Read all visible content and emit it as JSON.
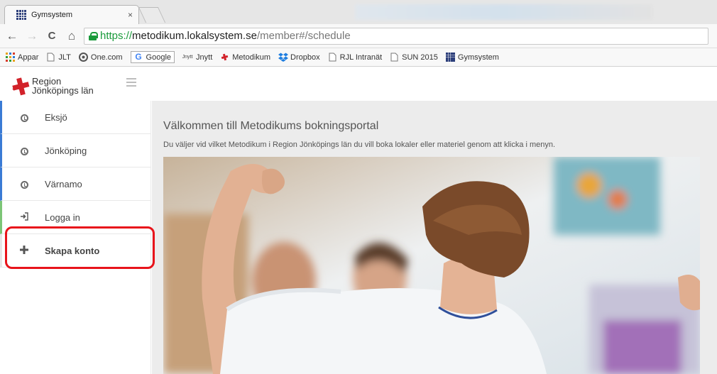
{
  "browser": {
    "tab_title": "Gymsystem",
    "tab_close": "×",
    "url_scheme": "https://",
    "url_host": "metodikum.lokalsystem.se",
    "url_path": "/member#/schedule",
    "nav": {
      "back": "←",
      "forward": "→",
      "reload": "C",
      "home": "⌂"
    },
    "bookmarks": [
      {
        "label": "Appar",
        "icon": "apps-grid-icon"
      },
      {
        "label": "JLT",
        "icon": "page-icon"
      },
      {
        "label": "One.com",
        "icon": "onecom-icon"
      },
      {
        "label": "Google",
        "icon": "google-icon"
      },
      {
        "label": "Jnytt",
        "icon": "jnytt-icon"
      },
      {
        "label": "Metodikum",
        "icon": "cross-icon"
      },
      {
        "label": "Dropbox",
        "icon": "dropbox-icon"
      },
      {
        "label": "RJL Intranät",
        "icon": "page-icon"
      },
      {
        "label": "SUN 2015",
        "icon": "page-icon"
      },
      {
        "label": "Gymsystem",
        "icon": "gymsystem-icon"
      }
    ]
  },
  "header": {
    "logo_line1": "Region",
    "logo_line2": "Jönköpings län"
  },
  "sidebar": {
    "items": [
      {
        "label": "Eksjö",
        "icon": "clock-icon"
      },
      {
        "label": "Jönköping",
        "icon": "clock-icon"
      },
      {
        "label": "Värnamo",
        "icon": "clock-icon"
      },
      {
        "label": "Logga in",
        "icon": "login-icon"
      },
      {
        "label": "Skapa konto",
        "icon": "plus-icon"
      }
    ]
  },
  "main": {
    "title": "Välkommen till Metodikums bokningsportal",
    "subtitle": "Du väljer vid vilket Metodikum i Region Jönköpings län du vill boka lokaler eller materiel genom att klicka i menyn."
  },
  "colors": {
    "accent_blue": "#3a7bd5",
    "accent_green": "#7cc576",
    "highlight_red": "#e8141b",
    "url_green": "#1a9a3b"
  }
}
